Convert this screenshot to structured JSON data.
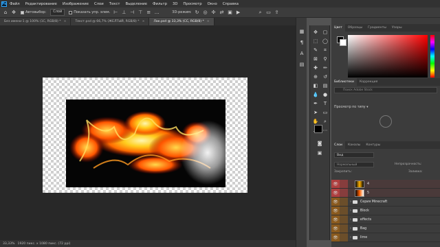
{
  "menubar": {
    "logo": "Ps",
    "items": [
      "Файл",
      "Редактирование",
      "Изображение",
      "Слои",
      "Текст",
      "Выделение",
      "Фильтр",
      "3D",
      "Просмотр",
      "Окно",
      "Справка"
    ]
  },
  "options": {
    "autoselect_label": "Автовыбор:",
    "autoselect_value": "Слой",
    "show_controls_label": "Показать упр. элем.",
    "mode_3d_label": "3D-режим:"
  },
  "tabs": [
    {
      "label": "Без имени-1 @ 100% (1С, RGB/8) *"
    },
    {
      "label": "Текст.psd @ 66,7% (ЖЕЛТЫЙ, RGB/8) *"
    },
    {
      "label": "Лак.psd @ 33,3% (СС, RGB/8) *"
    }
  ],
  "status": {
    "zoom": "33,33%",
    "doc_info": "1920 пикс. x 1080 пикс. (72 ppi)"
  },
  "color_panel": {
    "tabs": [
      "Цвет",
      "Образцы",
      "Градиенты",
      "Узоры"
    ]
  },
  "libraries_panel": {
    "tabs": [
      "Библиотеки",
      "Коррекция"
    ],
    "search_placeholder": "Поиск Adobe Stock",
    "view_label": "Просмотр по типу"
  },
  "layers_panel": {
    "tabs": [
      "Слои",
      "Каналы",
      "Контуры"
    ],
    "filter_label": "Вид",
    "blend_mode": "Нормальный",
    "opacity_label": "Непрозрачность:",
    "lock_label": "Закрепить:",
    "fill_label": "Заливка:",
    "layers": [
      {
        "name": "4",
        "type": "layer",
        "color": "#b04040"
      },
      {
        "name": "5",
        "type": "layer",
        "color": "#b04040"
      },
      {
        "name": "Серия Minecraft",
        "type": "folder",
        "color": "#8a5a1e"
      },
      {
        "name": "Block",
        "type": "folder",
        "color": "#8a5a1e"
      },
      {
        "name": "effects",
        "type": "folder",
        "color": "#8a5a1e"
      },
      {
        "name": "Bag",
        "type": "folder",
        "color": "#8a5a1e"
      },
      {
        "name": "lime",
        "type": "folder",
        "color": "#8a5a1e"
      }
    ]
  },
  "colors": {
    "menubar_bg": "#323232",
    "panel_bg": "#3c3c3c",
    "accent_red": "#b04040",
    "accent_orange": "#8a5a1e"
  }
}
